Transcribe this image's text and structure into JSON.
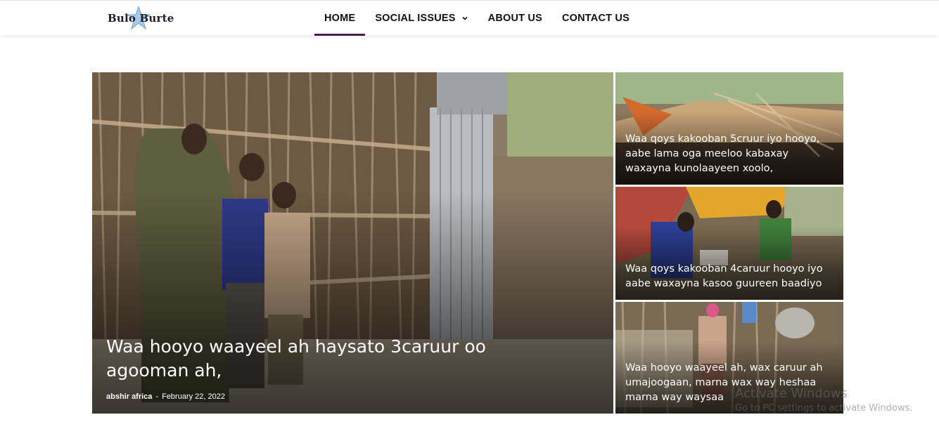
{
  "header": {
    "logo_text": "Bulo Burte",
    "nav": [
      {
        "label": "HOME",
        "active": true
      },
      {
        "label": "SOCIAL ISSUES",
        "has_dropdown": true
      },
      {
        "label": "ABOUT US"
      },
      {
        "label": "CONTACT US"
      }
    ],
    "accent_color": "#4a1d4a"
  },
  "featured": {
    "main": {
      "title": "Waa hooyo waayeel ah haysato 3caruur oo agooman ah,",
      "author": "abshir africa",
      "separator": "-",
      "date": "February 22, 2022"
    },
    "side": [
      {
        "title": "Waa qoys kakooban 5cruur iyo hooyo, aabe lama oga meeloo kabaxay waxayna kunolaayeen xoolo,"
      },
      {
        "title": "Waa qoys kakooban 4caruur hooyo iyo aabe waxayna kasoo guureen baadiyo"
      },
      {
        "title": "Waa hooyo waayeel ah, wax caruur ah umajoogaan, marna wax way heshaa marna way waysaa"
      }
    ]
  },
  "watermark": {
    "line1": "Activate Windows",
    "line2": "Go to PC settings to activate Windows."
  }
}
